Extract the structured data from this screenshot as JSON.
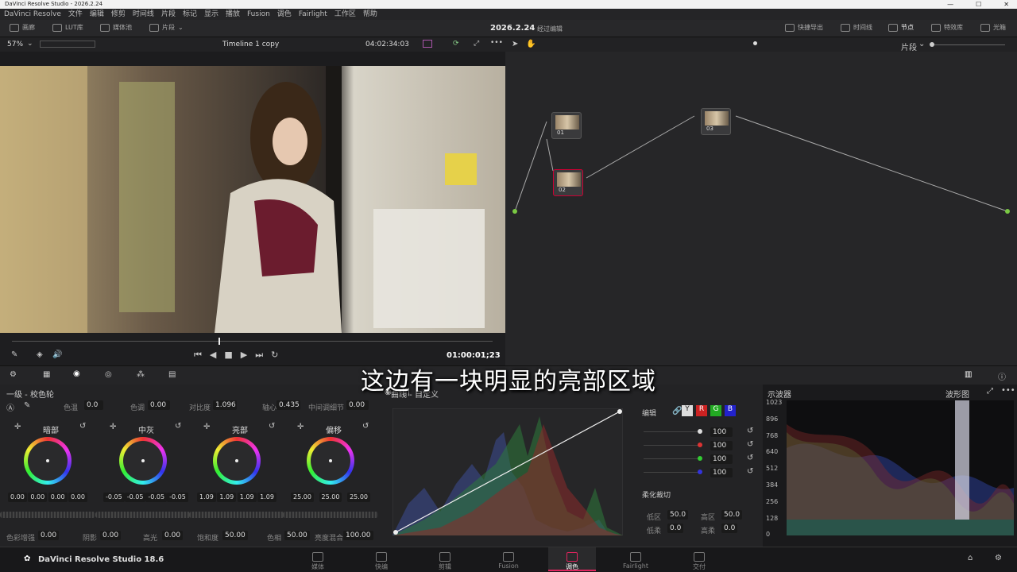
{
  "titlebar": {
    "title": "DaVinci Resolve Studio - 2026.2.24"
  },
  "menu": [
    "DaVinci Resolve",
    "文件",
    "编辑",
    "修剪",
    "时间线",
    "片段",
    "标记",
    "显示",
    "播放",
    "Fusion",
    "调色",
    "Fairlight",
    "工作区",
    "帮助"
  ],
  "toolbar": {
    "gallery": "画廊",
    "lut": "LUT库",
    "media": "媒体池",
    "clips": "片段",
    "project": "2026.2.24",
    "status": "经过编辑",
    "quick_export": "快捷导出",
    "timeline": "时间线",
    "nodes": "节点",
    "effects": "特效库",
    "lightbox": "光箱"
  },
  "viewer": {
    "zoom": "57%",
    "timeline": "Timeline 1 copy",
    "timecode": "04:02:34:03",
    "playhead_tc": "01:00:01;23",
    "scrubber_pos": 0.43
  },
  "nodegraph": {
    "mode": "片段",
    "nodes": [
      {
        "label": "01"
      },
      {
        "label": "02"
      },
      {
        "label": "03"
      }
    ]
  },
  "subtitle": "这边有一块明显的亮部区域",
  "wheels": {
    "title": "一级 - 校色轮",
    "temp_label": "色温",
    "temp": "0.0",
    "tint_label": "色调",
    "tint": "0.00",
    "contrast_label": "对比度",
    "contrast": "1.096",
    "pivot_label": "轴心",
    "pivot": "0.435",
    "middetail_label": "中间调细节",
    "middetail": "0.00",
    "items": [
      {
        "name": "暗部",
        "vals": [
          "0.00",
          "0.00",
          "0.00",
          "0.00"
        ]
      },
      {
        "name": "中灰",
        "vals": [
          "-0.05",
          "-0.05",
          "-0.05",
          "-0.05"
        ]
      },
      {
        "name": "亮部",
        "vals": [
          "1.09",
          "1.09",
          "1.09",
          "1.09"
        ]
      },
      {
        "name": "偏移",
        "vals": [
          "25.00",
          "25.00",
          "25.00"
        ]
      }
    ],
    "boost_label": "色彩增强",
    "boost": "0.00",
    "shadow_label": "阴影",
    "shadow": "0.00",
    "hl_label": "高光",
    "hl": "0.00",
    "sat_label": "饱和度",
    "sat": "50.00",
    "hue_label": "色相",
    "hue": "50.00",
    "lummix_label": "亮度混合",
    "lummix": "100.00"
  },
  "curves": {
    "title": "曲线 - 自定义"
  },
  "mixer": {
    "edit_label": "编辑",
    "channels": [
      "100",
      "100",
      "100",
      "100"
    ],
    "soft_label": "柔化裁切",
    "low_label": "低区",
    "low": "50.0",
    "high_label": "高区",
    "high": "50.0",
    "lowsoft_label": "低柔",
    "lowsoft": "0.0",
    "highsoft_label": "高柔",
    "highsoft": "0.0"
  },
  "scope": {
    "title": "示波器",
    "mode": "波形图",
    "ticks": [
      "1023",
      "896",
      "768",
      "640",
      "512",
      "384",
      "256",
      "128",
      "0"
    ]
  },
  "bottom": {
    "app": "DaVinci Resolve Studio 18.6",
    "pages": [
      "媒体",
      "快编",
      "剪辑",
      "Fusion",
      "调色",
      "Fairlight",
      "交付"
    ],
    "active": 4
  },
  "colors": {
    "accent": "#e0245e",
    "node_green": "#7ac943",
    "node_blue": "#3da9fc"
  }
}
